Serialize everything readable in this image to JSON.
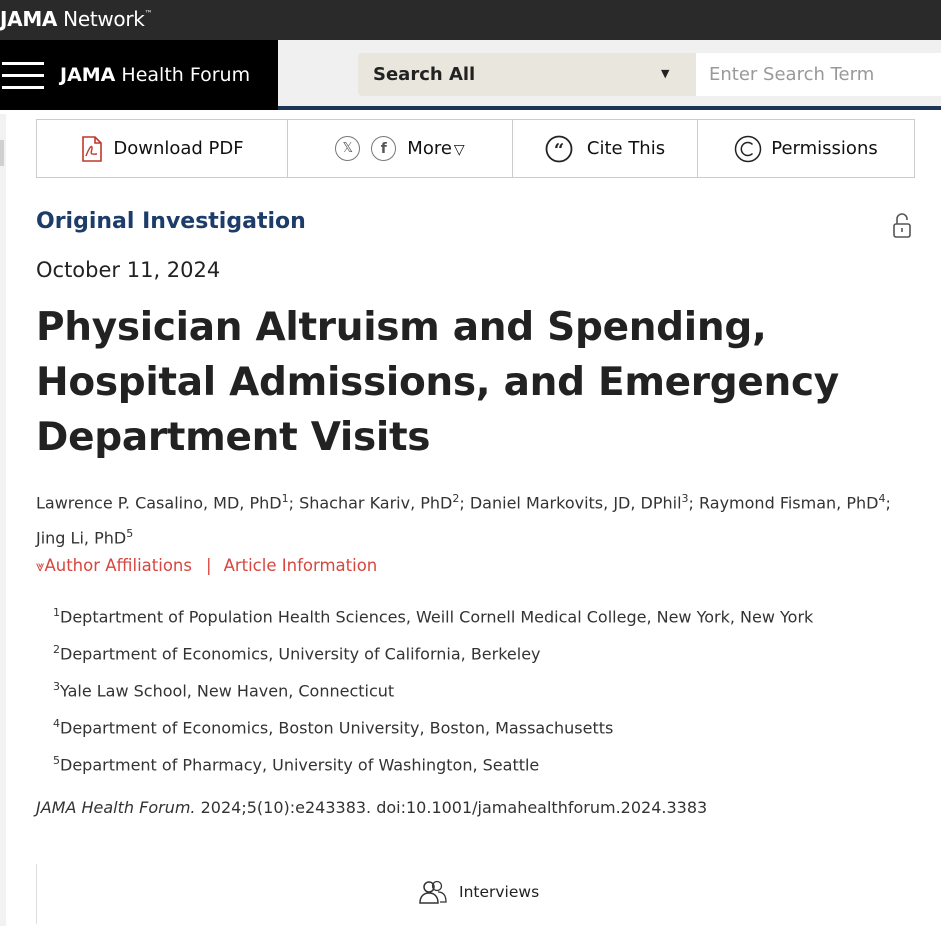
{
  "network": {
    "brand_bold": "JAMA",
    "brand_rest": " Network",
    "tm": "™"
  },
  "journal": {
    "name_bold": "JAMA",
    "name_rest": " Health Forum",
    "search_scope": "Search All",
    "search_placeholder": "Enter Search Term"
  },
  "toolbar": {
    "download_label": "Download PDF",
    "more_label": "More",
    "cite_label": "Cite This",
    "permissions_label": "Permissions"
  },
  "article": {
    "type": "Original Investigation",
    "date": "October 11, 2024",
    "title": "Physician Altruism and Spending, Hospital Admissions, and Emergency Department Visits",
    "authors": [
      {
        "name": "Lawrence P. Casalino, MD, PhD",
        "sup": "1",
        "sep": "; "
      },
      {
        "name": "Shachar Kariv, PhD",
        "sup": "2",
        "sep": "; "
      },
      {
        "name": "Daniel Markovits, JD, DPhil",
        "sup": "3",
        "sep": "; "
      },
      {
        "name": "Raymond Fisman, PhD",
        "sup": "4",
        "sep": ";"
      },
      {
        "name": "Jing Li, PhD",
        "sup": "5",
        "sep": ""
      }
    ],
    "links": {
      "affiliations": "Author Affiliations",
      "separator": "|",
      "article_info": "Article Information"
    },
    "affiliations": [
      {
        "sup": "1",
        "text": "Deptartment of Population Health Sciences, Weill Cornell Medical College, New York, New York"
      },
      {
        "sup": "2",
        "text": "Department of Economics, University of California, Berkeley"
      },
      {
        "sup": "3",
        "text": "Yale Law School, New Haven, Connecticut"
      },
      {
        "sup": "4",
        "text": "Department of Economics, Boston University, Boston, Massachusetts"
      },
      {
        "sup": "5",
        "text": "Department of Pharmacy, University of Washington, Seattle"
      }
    ],
    "citation": {
      "journal": "JAMA Health Forum.",
      "rest": " 2024;5(10):e243383. doi:10.1001/jamahealthforum.2024.3383"
    }
  },
  "interviews_label": "Interviews",
  "colors": {
    "accent_blue": "#1d3c6a",
    "link_red": "#d8463f",
    "header_dark": "#2a2a2a"
  }
}
